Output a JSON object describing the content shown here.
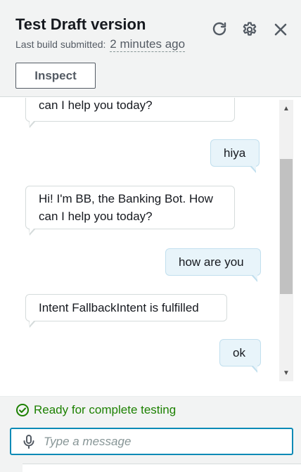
{
  "header": {
    "title": "Test Draft version",
    "subtitle_label": "Last build submitted:",
    "subtitle_time": "2 minutes ago",
    "inspect_label": "Inspect",
    "icons": [
      "refresh-icon",
      "settings-icon",
      "close-icon"
    ]
  },
  "messages": [
    {
      "from": "bot",
      "lines": [
        "can I help you today?"
      ]
    },
    {
      "from": "user",
      "lines": [
        "hiya"
      ]
    },
    {
      "from": "bot",
      "lines": [
        "Hi! I'm BB, the Banking Bot. How",
        "can I help you today?"
      ]
    },
    {
      "from": "user",
      "lines": [
        "how are you"
      ]
    },
    {
      "from": "bot",
      "lines": [
        "Intent FallbackIntent is fulfilled"
      ]
    },
    {
      "from": "user",
      "lines": [
        "ok"
      ]
    }
  ],
  "footer": {
    "status": "Ready for complete testing",
    "input_placeholder": "Type a message",
    "input_value": ""
  },
  "colors": {
    "accent": "#0a8ab6",
    "success": "#1d8102",
    "user_bubble": "#e8f4fa",
    "header_bg": "#f2f3f3"
  }
}
